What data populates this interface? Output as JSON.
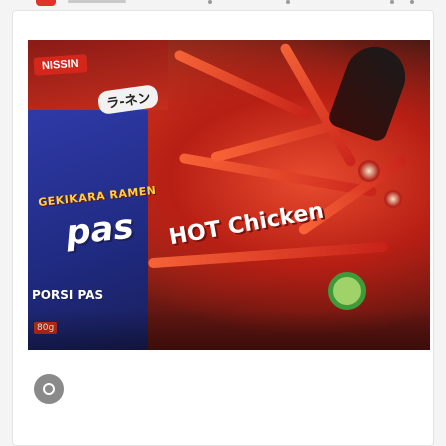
{
  "product": {
    "brand_badge": "NISSIN",
    "jp_label": "ラ-ネン",
    "flavor_line": "GEKIKARA RAMEN",
    "big_word": "pas",
    "headline": "HOT Chicken",
    "portion_label": "PORSI PAS",
    "weight_label": "80g"
  },
  "controls": {
    "circle_button_icon": "circle-outline-icon"
  },
  "colors": {
    "background": "#f4f4f4",
    "card": "#ffffff",
    "brand_red": "#d3271c",
    "pack_blue": "#2f3aa8",
    "control_grey": "#8a8a8a"
  }
}
